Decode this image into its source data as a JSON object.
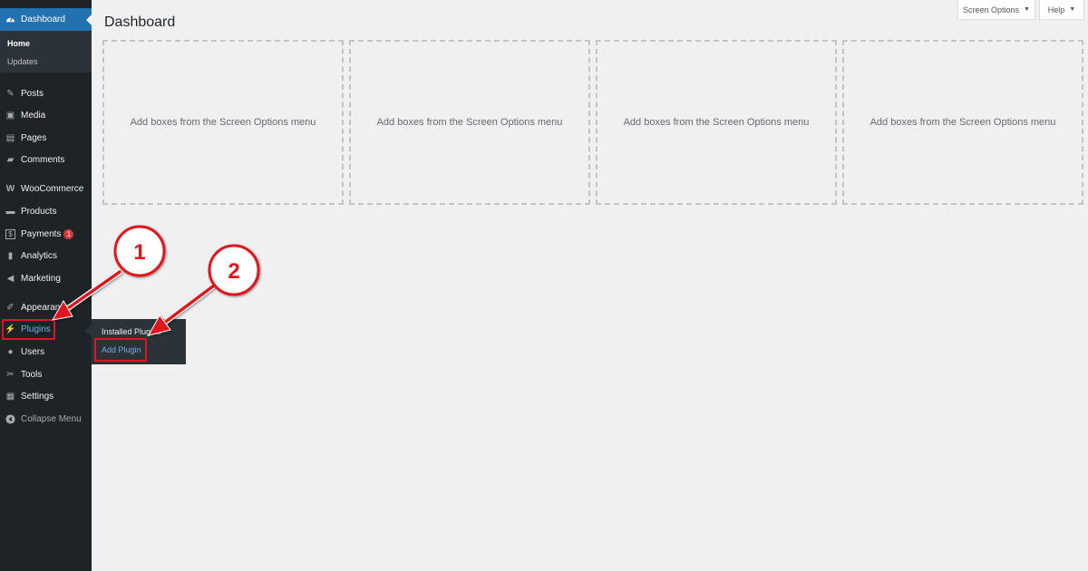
{
  "sidebar": {
    "dashboard_label": "Dashboard",
    "submenu": [
      "Home",
      "Updates"
    ],
    "items": [
      {
        "label": "Posts",
        "icon": "pin-icon",
        "glyph": "✎"
      },
      {
        "label": "Media",
        "icon": "media-icon",
        "glyph": "▣"
      },
      {
        "label": "Pages",
        "icon": "pages-icon",
        "glyph": "▤"
      },
      {
        "label": "Comments",
        "icon": "comments-icon",
        "glyph": "▰"
      },
      {
        "label": "WooCommerce",
        "icon": "woocommerce-icon",
        "glyph": "W"
      },
      {
        "label": "Products",
        "icon": "products-icon",
        "glyph": "▬"
      },
      {
        "label": "Payments",
        "icon": "payments-icon",
        "glyph": "$",
        "badge": "1"
      },
      {
        "label": "Analytics",
        "icon": "analytics-icon",
        "glyph": "▮"
      },
      {
        "label": "Marketing",
        "icon": "megaphone-icon",
        "glyph": "◀"
      },
      {
        "label": "Appearance",
        "icon": "brush-icon",
        "glyph": "✐"
      },
      {
        "label": "Plugins",
        "icon": "plug-icon",
        "glyph": "⚡"
      },
      {
        "label": "Users",
        "icon": "users-icon",
        "glyph": "●"
      },
      {
        "label": "Tools",
        "icon": "wrench-icon",
        "glyph": "✂"
      },
      {
        "label": "Settings",
        "icon": "settings-icon",
        "glyph": "▦"
      }
    ],
    "collapse_label": "Collapse Menu"
  },
  "flyout": {
    "items": [
      "Installed Plugins",
      "Add Plugin"
    ]
  },
  "header": {
    "title": "Dashboard",
    "screen_options": "Screen Options",
    "help": "Help"
  },
  "boxes": [
    "Add boxes from the Screen Options menu",
    "Add boxes from the Screen Options menu",
    "Add boxes from the Screen Options menu",
    "Add boxes from the Screen Options menu"
  ],
  "annotations": {
    "markers": [
      "1",
      "2"
    ],
    "color": "#e0141e"
  },
  "colors": {
    "sidebar_bg": "#1d2327",
    "accent": "#2271b1",
    "hover": "#72aee6"
  }
}
